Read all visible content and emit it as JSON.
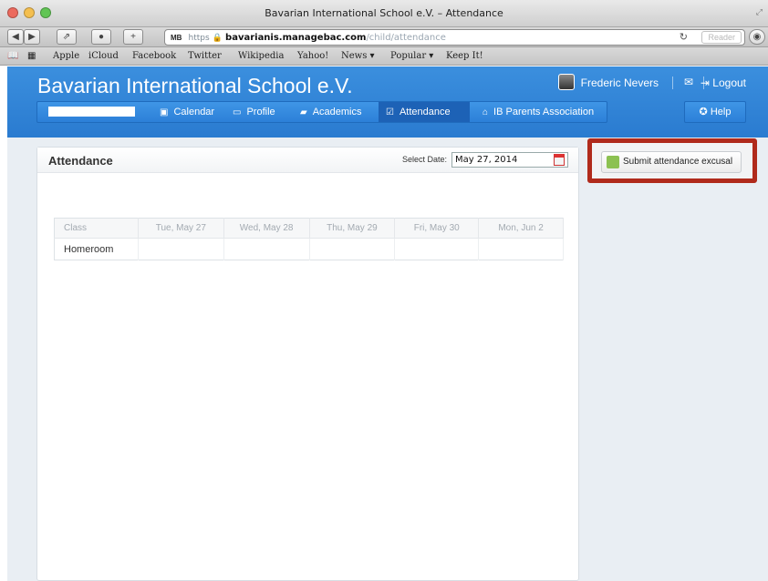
{
  "window": {
    "title": "Bavarian International School e.V. – Attendance",
    "colors": {
      "close": "#ec6a5e",
      "minimize": "#f4bf4f",
      "zoom": "#61c554"
    }
  },
  "toolbar": {
    "back_icon": "back-arrow-icon",
    "forward_icon": "forward-arrow-icon",
    "share_icon": "share-icon",
    "plus_icon": "plus-icon",
    "url": {
      "favicon": "MB",
      "scheme": "https",
      "domain": "bavarianis.managebac.com",
      "path": "/child/attendance"
    },
    "reload_icon": "reload-icon",
    "reader_label": "Reader"
  },
  "bookmarks": [
    "Apple",
    "iCloud",
    "Facebook",
    "Twitter",
    "Wikipedia",
    "Yahoo!",
    "News ▾",
    "Popular ▾",
    "Keep It!"
  ],
  "header": {
    "school_name": "Bavarian International School e.V.",
    "user_name": "Frederic Nevers",
    "logout_label": "Logout",
    "brand_color": "#2f83d6"
  },
  "nav": {
    "items": [
      {
        "label": "Calendar",
        "icon": "calendar-icon"
      },
      {
        "label": "Profile",
        "icon": "id-card-icon"
      },
      {
        "label": "Academics",
        "icon": "book-icon"
      },
      {
        "label": "Attendance",
        "icon": "checkbox-icon",
        "active": true
      },
      {
        "label": "IB Parents Association",
        "icon": "home-icon"
      }
    ],
    "help_label": "Help"
  },
  "attendance": {
    "panel_title": "Attendance",
    "select_date_label": "Select Date:",
    "selected_date": "May 27, 2014",
    "columns": [
      "Class",
      "Tue, May 27",
      "Wed, May 28",
      "Thu, May 29",
      "Fri, May 30",
      "Mon, Jun 2"
    ],
    "rows": [
      {
        "class": "Homeroom",
        "cells": [
          "",
          "",
          "",
          "",
          ""
        ]
      }
    ]
  },
  "sidebar": {
    "submit_label": "Submit attendance excusal",
    "highlight_color": "#b02a1b"
  }
}
